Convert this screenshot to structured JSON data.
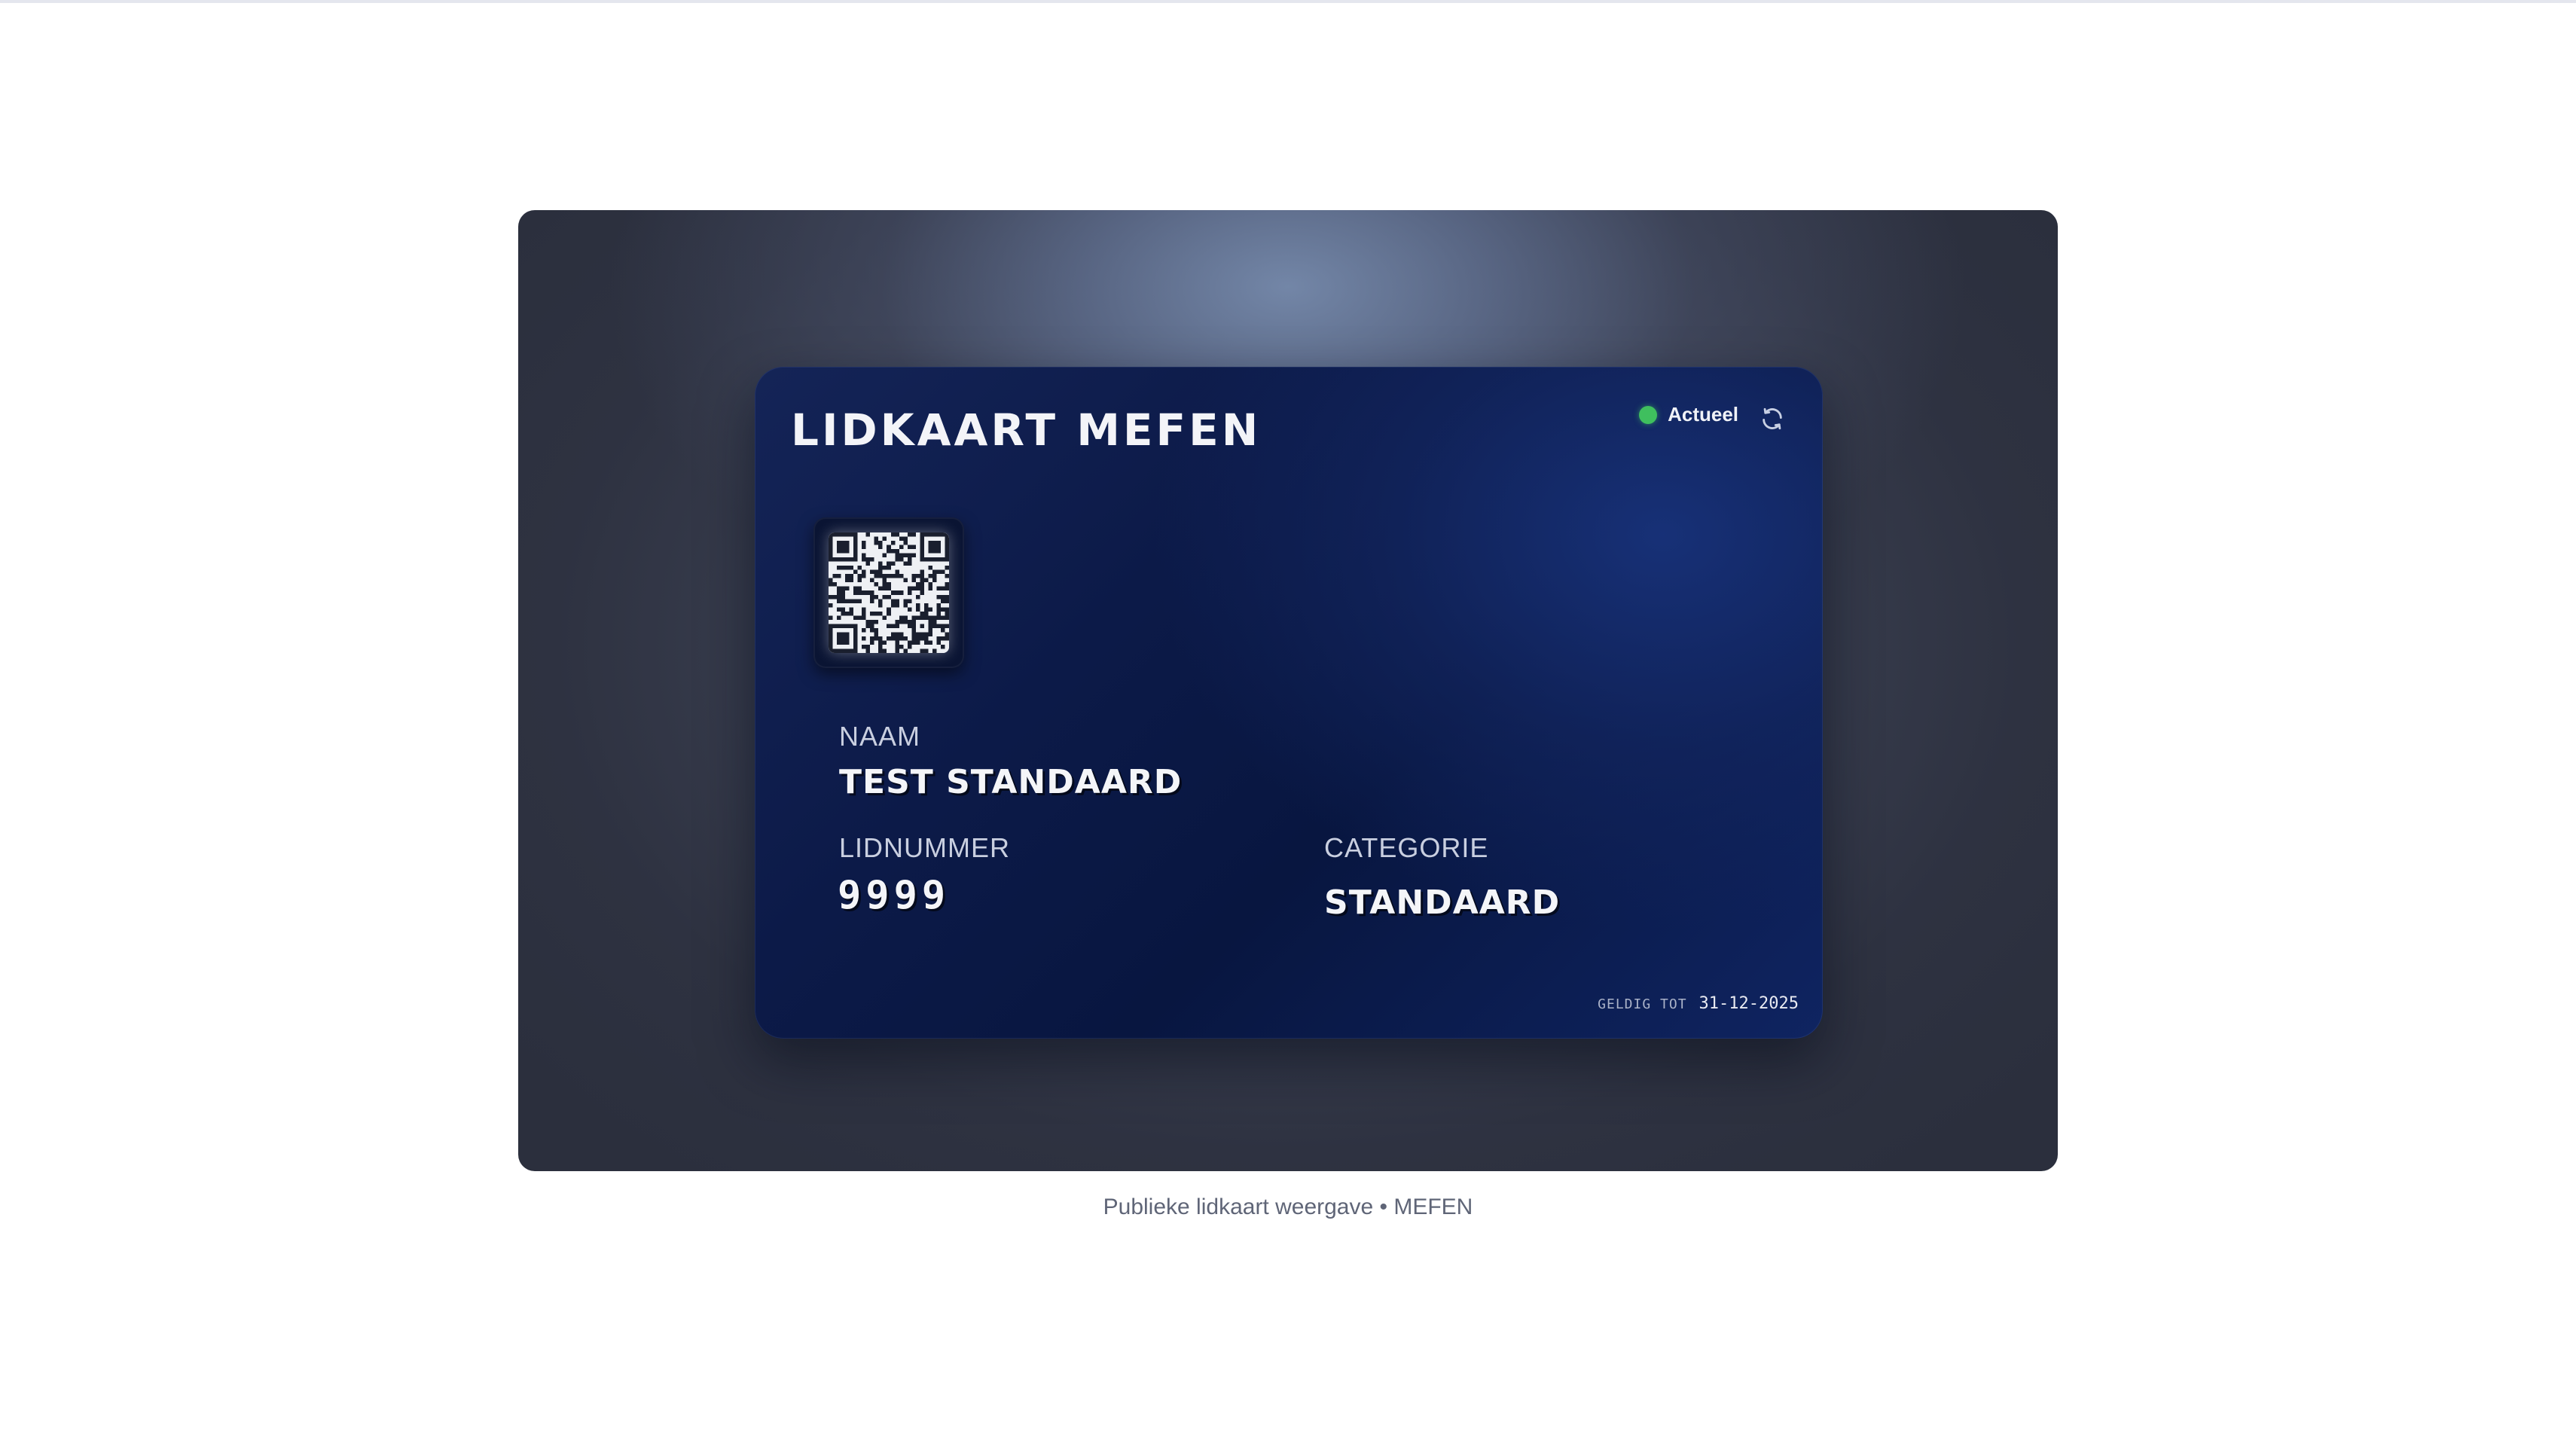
{
  "card": {
    "title": "LIDKAART MEFEN",
    "status_label": "Actueel",
    "status_color": "#3fbf5e",
    "refresh_icon": "refresh-icon",
    "qr_icon": "qr-code-icon",
    "name_label": "NAAM",
    "name_value": "TEST STANDAARD",
    "member_label": "LIDNUMMER",
    "member_value": "9999",
    "category_label": "CATEGORIE",
    "category_value": "STANDAARD",
    "valid_label": "GELDIG TOT",
    "valid_date": "31-12-2025"
  },
  "footer": {
    "caption": "Publieke lidkaart weergave • MEFEN"
  }
}
